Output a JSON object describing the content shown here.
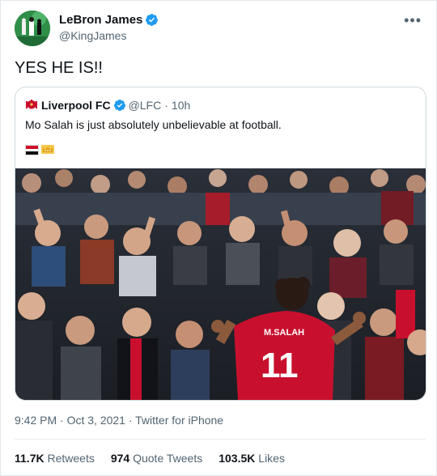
{
  "author": {
    "name": "LeBron James",
    "handle": "@KingJames"
  },
  "tweet_text": "YES HE IS!!",
  "quoted": {
    "name": "Liverpool FC",
    "handle": "@LFC",
    "separator": "·",
    "time": "10h",
    "text": "Mo Salah is just absolutely unbelievable at football.",
    "emojis": [
      "egypt-flag",
      "crown"
    ],
    "shirt_name": "M.SALAH",
    "shirt_number": "11"
  },
  "timestamp": "9:42 PM · Oct 3, 2021 · Twitter for iPhone",
  "stats": [
    {
      "value": "11.7K",
      "label": "Retweets"
    },
    {
      "value": "974",
      "label": "Quote Tweets"
    },
    {
      "value": "103.5K",
      "label": "Likes"
    }
  ],
  "colors": {
    "verified": "#1d9bf0",
    "lfc_red": "#c8102e",
    "secondary_text": "#536471",
    "border": "#cfd9de"
  }
}
